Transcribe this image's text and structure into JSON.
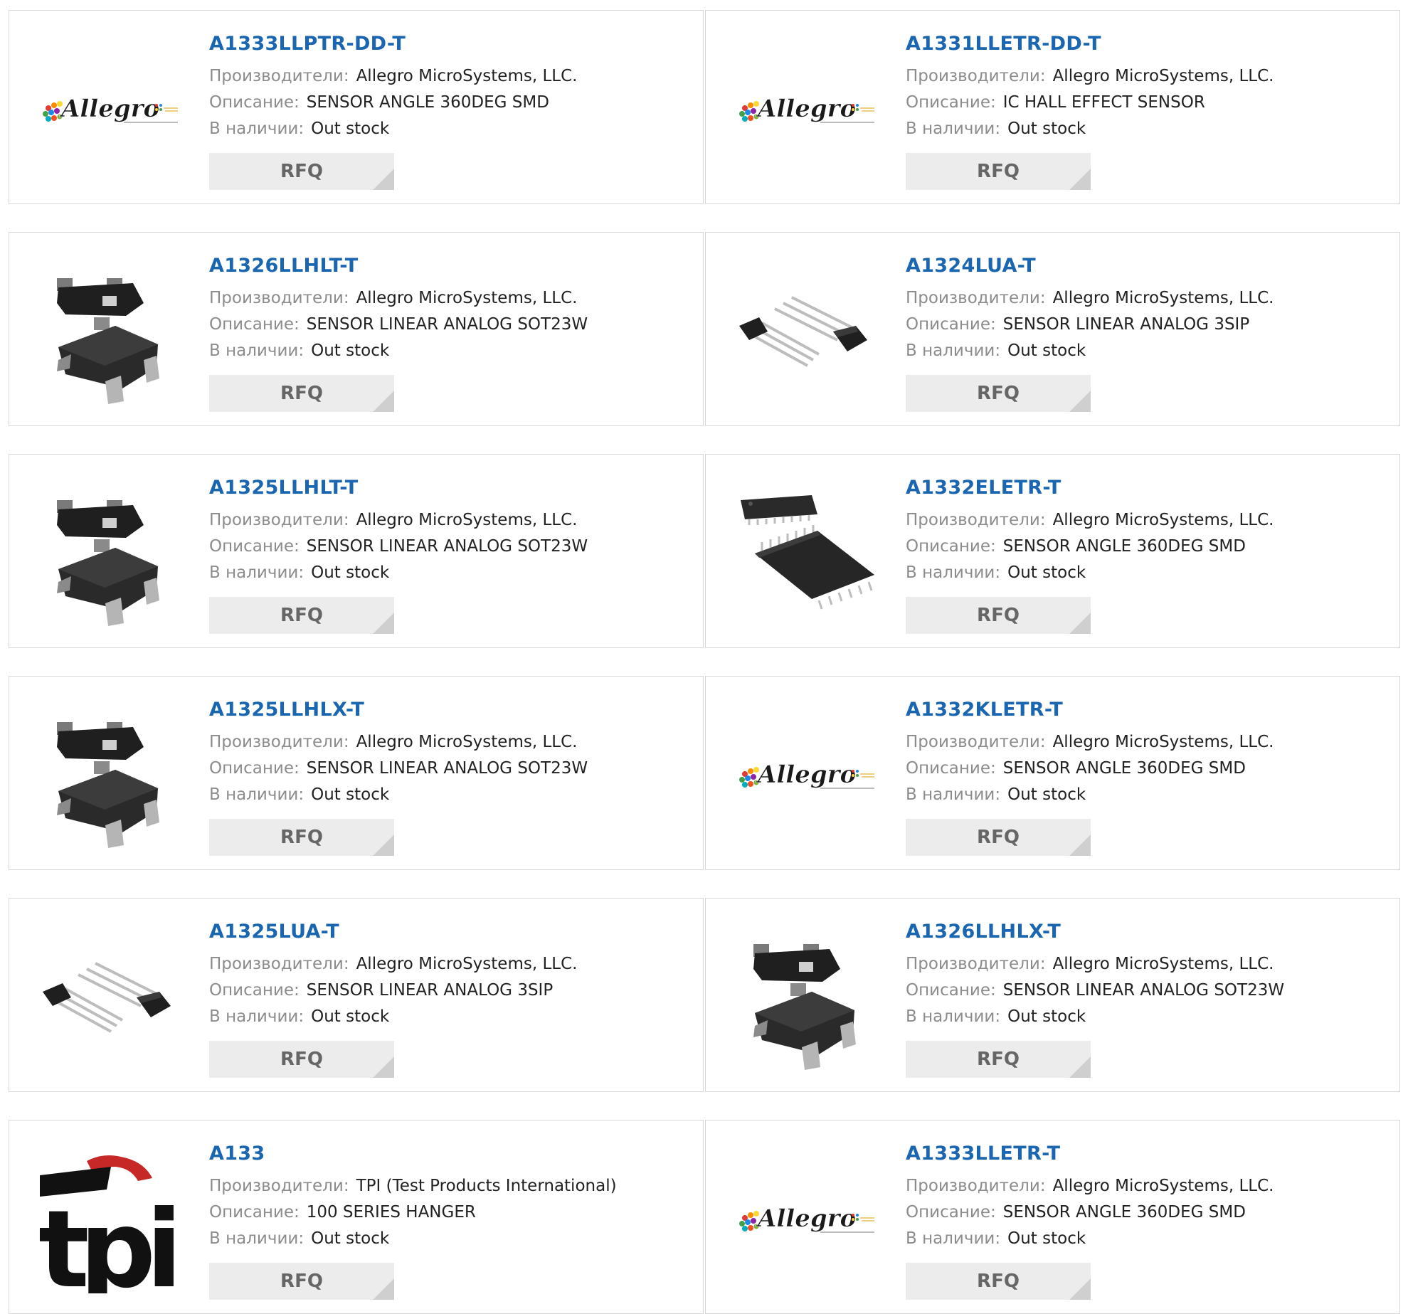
{
  "labels": {
    "manufacturer": "Производители:",
    "description": "Описание:",
    "stock": "В наличии:",
    "rfq": "RFQ"
  },
  "products": [
    {
      "part": "A1333LLPTR-DD-T",
      "manufacturer": "Allegro MicroSystems, LLC.",
      "description": "SENSOR ANGLE 360DEG SMD",
      "stock": "Out stock",
      "image": "allegro-logo"
    },
    {
      "part": "A1331LLETR-DD-T",
      "manufacturer": "Allegro MicroSystems, LLC.",
      "description": "IC HALL EFFECT SENSOR",
      "stock": "Out stock",
      "image": "allegro-logo"
    },
    {
      "part": "A1326LLHLT-T",
      "manufacturer": "Allegro MicroSystems, LLC.",
      "description": "SENSOR LINEAR ANALOG SOT23W",
      "stock": "Out stock",
      "image": "sot23-package"
    },
    {
      "part": "A1324LUA-T",
      "manufacturer": "Allegro MicroSystems, LLC.",
      "description": "SENSOR LINEAR ANALOG 3SIP",
      "stock": "Out stock",
      "image": "sip3-package"
    },
    {
      "part": "A1325LLHLT-T",
      "manufacturer": "Allegro MicroSystems, LLC.",
      "description": "SENSOR LINEAR ANALOG SOT23W",
      "stock": "Out stock",
      "image": "sot23-package"
    },
    {
      "part": "A1332ELETR-T",
      "manufacturer": "Allegro MicroSystems, LLC.",
      "description": "SENSOR ANGLE 360DEG SMD",
      "stock": "Out stock",
      "image": "tssop-package"
    },
    {
      "part": "A1325LLHLX-T",
      "manufacturer": "Allegro MicroSystems, LLC.",
      "description": "SENSOR LINEAR ANALOG SOT23W",
      "stock": "Out stock",
      "image": "sot23-package"
    },
    {
      "part": "A1332KLETR-T",
      "manufacturer": "Allegro MicroSystems, LLC.",
      "description": "SENSOR ANGLE 360DEG SMD",
      "stock": "Out stock",
      "image": "allegro-logo"
    },
    {
      "part": "A1325LUA-T",
      "manufacturer": "Allegro MicroSystems, LLC.",
      "description": "SENSOR LINEAR ANALOG 3SIP",
      "stock": "Out stock",
      "image": "sip3-package"
    },
    {
      "part": "A1326LLHLX-T",
      "manufacturer": "Allegro MicroSystems, LLC.",
      "description": "SENSOR LINEAR ANALOG SOT23W",
      "stock": "Out stock",
      "image": "sot23-package"
    },
    {
      "part": "A133",
      "manufacturer": "TPI (Test Products International)",
      "description": "100 SERIES HANGER",
      "stock": "Out stock",
      "image": "tpi-logo",
      "logo_text": "tpi"
    },
    {
      "part": "A1333LLETR-T",
      "manufacturer": "Allegro MicroSystems, LLC.",
      "description": "SENSOR ANGLE 360DEG SMD",
      "stock": "Out stock",
      "image": "allegro-logo"
    }
  ],
  "colors": {
    "link": "#1a66b1",
    "label": "#8c8c8c",
    "value": "#222222",
    "rfq_bg": "#ececec",
    "border": "#d8d8d8"
  }
}
